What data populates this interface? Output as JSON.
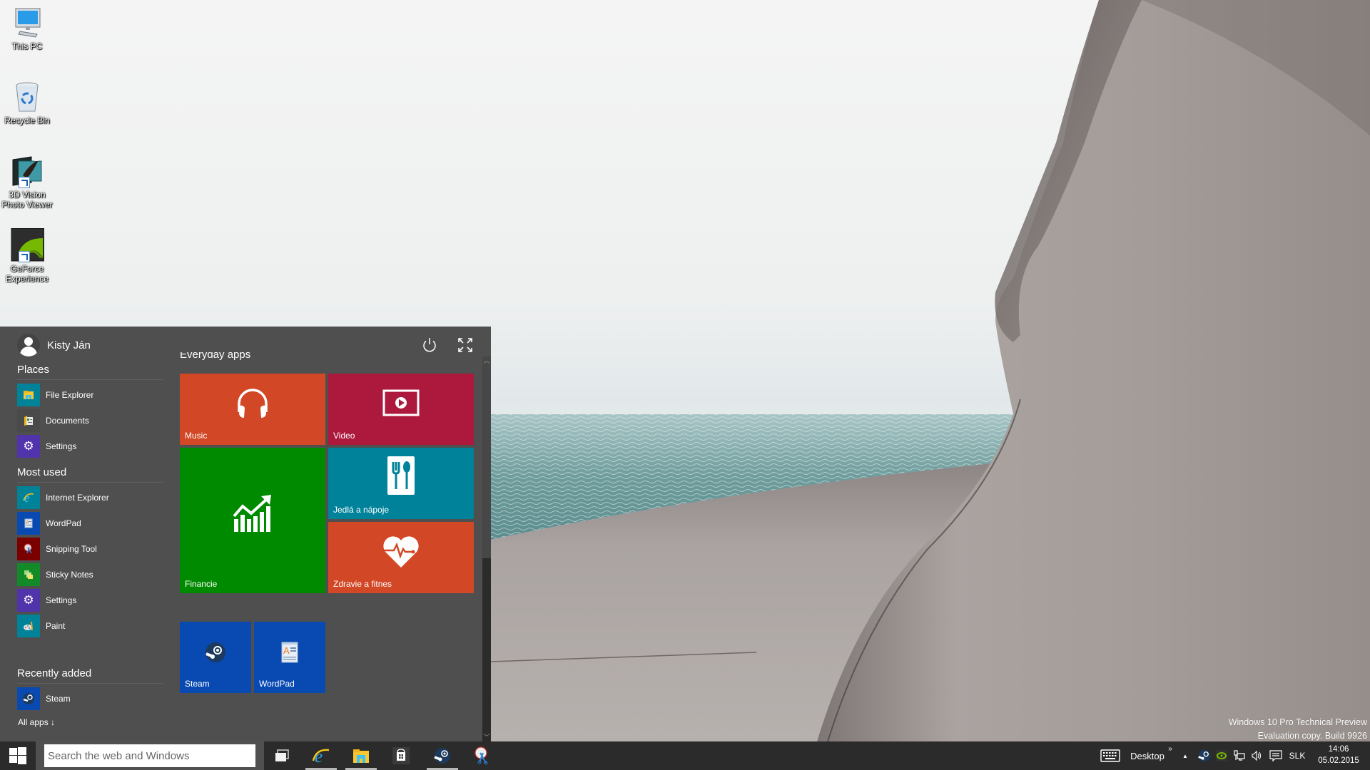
{
  "desktop": {
    "icons": [
      {
        "label": "This PC",
        "icon": "computer-icon"
      },
      {
        "label": "Recycle Bin",
        "icon": "recycle-bin-icon"
      },
      {
        "label": "3D Vision Photo Viewer",
        "label_lines": [
          "3D Vision",
          "Photo Viewer"
        ],
        "icon": "3d-vision-icon",
        "shortcut": true
      },
      {
        "label": "GeForce Experience",
        "label_lines": [
          "GeForce",
          "Experience"
        ],
        "icon": "geforce-icon",
        "shortcut": true
      }
    ],
    "watermark": {
      "line1": "Windows 10 Pro Technical Preview",
      "line2": "Evaluation copy. Build 9926"
    }
  },
  "start_menu": {
    "user_name": "Kisty Ján",
    "power_icon": "power-icon",
    "expand_icon": "fullscreen-icon",
    "places": {
      "title": "Places",
      "items": [
        {
          "label": "File Explorer",
          "icon": "file-explorer-icon",
          "color": "#008299"
        },
        {
          "label": "Documents",
          "icon": "documents-icon",
          "color": "#4a4a4a"
        },
        {
          "label": "Settings",
          "icon": "gear-icon",
          "color": "#5133ab"
        }
      ]
    },
    "most_used": {
      "title": "Most used",
      "items": [
        {
          "label": "Internet Explorer",
          "icon": "internet-explorer-icon",
          "color": "#008299"
        },
        {
          "label": "WordPad",
          "icon": "wordpad-icon",
          "color": "#094ab2"
        },
        {
          "label": "Snipping Tool",
          "icon": "snipping-tool-icon",
          "color": "#7a0000"
        },
        {
          "label": "Sticky Notes",
          "icon": "sticky-notes-icon",
          "color": "#138a28"
        },
        {
          "label": "Settings",
          "icon": "gear-icon",
          "color": "#5133ab"
        },
        {
          "label": "Paint",
          "icon": "paint-icon",
          "color": "#008299"
        }
      ]
    },
    "recently_added": {
      "title": "Recently added",
      "items": [
        {
          "label": "Steam",
          "icon": "steam-icon",
          "color": "#094ab2"
        }
      ]
    },
    "all_apps": "All apps ↓",
    "tile_group_title": "Everyday apps",
    "tiles": [
      {
        "label": "Music",
        "icon": "headphones-icon",
        "color": "#d24726"
      },
      {
        "label": "Video",
        "icon": "video-icon",
        "color": "#ac193d"
      },
      {
        "label": "Financie",
        "icon": "finance-chart-icon",
        "color": "#008a00"
      },
      {
        "label": "Jedlá a nápoje",
        "icon": "fork-spoon-icon",
        "color": "#00829a"
      },
      {
        "label": "Zdravie a fitnes",
        "icon": "heart-pulse-icon",
        "color": "#d24726"
      },
      {
        "label": "Steam",
        "icon": "steam-icon",
        "color": "#094ab2"
      },
      {
        "label": "WordPad",
        "icon": "wordpad-icon",
        "color": "#094ab2"
      }
    ]
  },
  "taskbar": {
    "start_icon": "windows-logo-icon",
    "search_placeholder": "Search the web and Windows",
    "pinned": [
      {
        "name": "Task View",
        "icon": "task-view-icon",
        "running": false
      },
      {
        "name": "Internet Explorer",
        "icon": "internet-explorer-icon",
        "running": true
      },
      {
        "name": "File Explorer",
        "icon": "file-explorer-icon",
        "running": true
      },
      {
        "name": "Store",
        "icon": "store-icon",
        "running": false
      },
      {
        "name": "Steam",
        "icon": "steam-icon",
        "running": true
      },
      {
        "name": "Snipping Tool",
        "icon": "snipping-tool-icon",
        "running": false
      }
    ],
    "tray": {
      "keyboard_icon": "touch-keyboard-icon",
      "desktop_label": "Desktop",
      "desktop_chevron": "»",
      "show_hidden": "▲",
      "icons": [
        "steam-icon",
        "nvidia-icon",
        "network-icon",
        "volume-icon",
        "action-center-icon"
      ],
      "language": "SLK",
      "time": "14:06",
      "date": "05.02.2015"
    }
  }
}
